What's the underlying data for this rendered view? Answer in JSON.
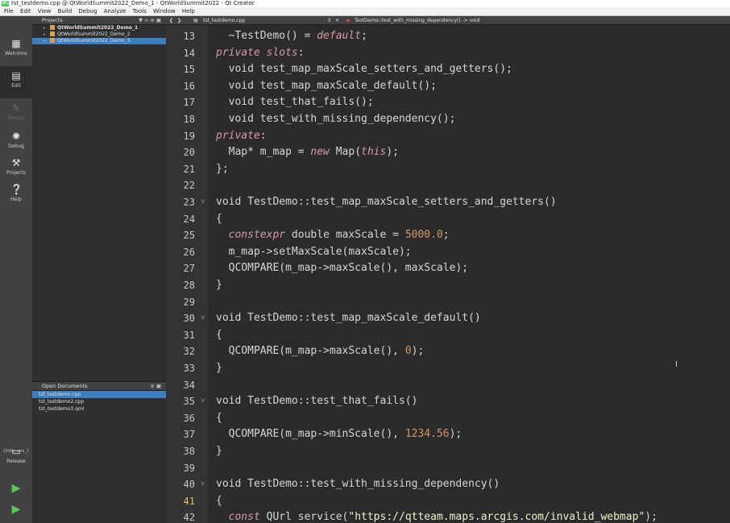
{
  "window": {
    "title": "tst_testdemo.cpp @ QtWorldSummit2022_Demo_1 - QtWorldSummit2022 - Qt Creator",
    "logo_text": "QC"
  },
  "menu": [
    "File",
    "Edit",
    "View",
    "Build",
    "Debug",
    "Analyze",
    "Tools",
    "Window",
    "Help"
  ],
  "modes": [
    {
      "label": "Welcome",
      "icon": "grid-icon"
    },
    {
      "label": "Edit",
      "icon": "document-icon"
    },
    {
      "label": "Design",
      "icon": "pencil-icon"
    },
    {
      "label": "Debug",
      "icon": "bug-icon"
    },
    {
      "label": "Projects",
      "icon": "wrench-icon"
    },
    {
      "label": "Help",
      "icon": "help-icon"
    }
  ],
  "kit": {
    "label": "QtWo...mo_1",
    "build_mode": "Release"
  },
  "projects_pane": {
    "title": "Projects",
    "items": [
      {
        "label": "QtWorldSummit2022_Demo_1"
      },
      {
        "label": "QtWorldSummit2022_Demo_2"
      },
      {
        "label": "QtWorldSummit2022_Demo_3"
      }
    ]
  },
  "open_documents": {
    "title": "Open Documents",
    "items": [
      "tst_testdemo.cpp",
      "tst_testdemo2.cpp",
      "tst_testdemo3.qml"
    ]
  },
  "editor": {
    "file_tab": "tst_testdemo.cpp",
    "symbol": "TestDemo::test_with_missing_dependency() -> void",
    "current_line": 41,
    "lines": [
      {
        "n": "13",
        "html": "  ~TestDemo() = <span class=\"kw\">default</span>;"
      },
      {
        "n": "14",
        "html": "<span class=\"kw\">private slots</span>:"
      },
      {
        "n": "15",
        "html": "  void test_map_maxScale_setters_and_getters();"
      },
      {
        "n": "16",
        "html": "  void test_map_maxScale_default();"
      },
      {
        "n": "17",
        "html": "  void test_that_fails();"
      },
      {
        "n": "18",
        "html": "  void test_with_missing_dependency();"
      },
      {
        "n": "19",
        "html": "<span class=\"kw\">private</span>:"
      },
      {
        "n": "20",
        "html": "  Map* m_map = <span class=\"kw\">new</span> Map(<span class=\"kw\">this</span>);"
      },
      {
        "n": "21",
        "html": "};"
      },
      {
        "n": "22",
        "html": ""
      },
      {
        "n": "23",
        "fold": true,
        "html": "void TestDemo::test_map_maxScale_setters_and_getters()"
      },
      {
        "n": "24",
        "html": "{"
      },
      {
        "n": "25",
        "html": "  <span class=\"kw\">constexpr</span> double maxScale = <span class=\"num\">5000.0</span>;"
      },
      {
        "n": "26",
        "html": "  m_map-&gt;setMaxScale(maxScale);"
      },
      {
        "n": "27",
        "html": "  QCOMPARE(m_map-&gt;maxScale(), maxScale);"
      },
      {
        "n": "28",
        "html": "}"
      },
      {
        "n": "29",
        "html": ""
      },
      {
        "n": "30",
        "fold": true,
        "html": "void TestDemo::test_map_maxScale_default()"
      },
      {
        "n": "31",
        "html": "{"
      },
      {
        "n": "32",
        "html": "  QCOMPARE(m_map-&gt;maxScale(), <span class=\"num\">0</span>);"
      },
      {
        "n": "33",
        "html": "}"
      },
      {
        "n": "34",
        "html": ""
      },
      {
        "n": "35",
        "fold": true,
        "html": "void TestDemo::test_that_fails()"
      },
      {
        "n": "36",
        "html": "{"
      },
      {
        "n": "37",
        "html": "  QCOMPARE(m_map-&gt;minScale(), <span class=\"num\">1234.56</span>);"
      },
      {
        "n": "38",
        "html": "}"
      },
      {
        "n": "39",
        "html": ""
      },
      {
        "n": "40",
        "fold": true,
        "html": "void TestDemo::test_with_missing_dependency()"
      },
      {
        "n": "41",
        "html": "{"
      },
      {
        "n": "42",
        "html": "  <span class=\"kw\">const</span> QUrl service(<span class=\"str\">\"https://qtteam.maps.arcgis.com/invalid_webmap\"</span>);"
      }
    ]
  }
}
